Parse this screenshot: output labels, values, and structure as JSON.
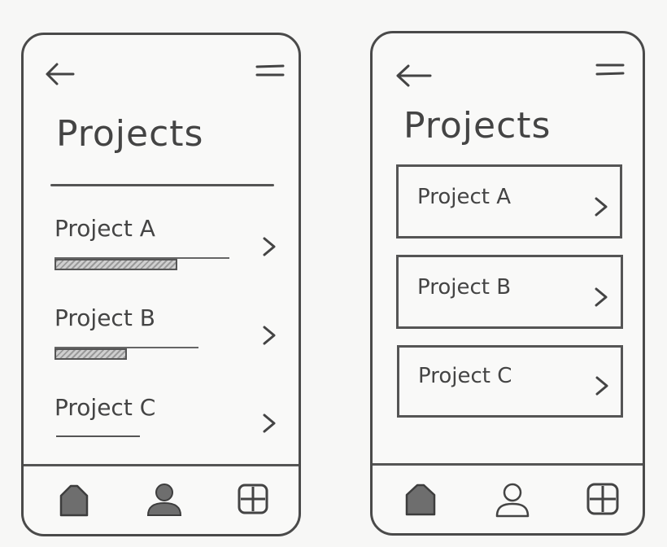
{
  "screens": [
    {
      "title": "Projects",
      "projects": [
        {
          "label": "Project A",
          "progress": 0.7
        },
        {
          "label": "Project B",
          "progress": 0.5
        },
        {
          "label": "Project C"
        }
      ]
    },
    {
      "title": "Projects",
      "projects": [
        {
          "label": "Project A"
        },
        {
          "label": "Project B"
        },
        {
          "label": "Project C"
        }
      ]
    }
  ],
  "icons": {
    "back": "back-arrow-icon",
    "menu": "menu-icon",
    "chevron": "chevron-right-icon",
    "nav": [
      "home-icon",
      "profile-icon",
      "grid-icon"
    ]
  },
  "colors": {
    "stroke": "#4a4a4a",
    "paper": "#f7f7f6",
    "fill": "#6e6e6e"
  }
}
